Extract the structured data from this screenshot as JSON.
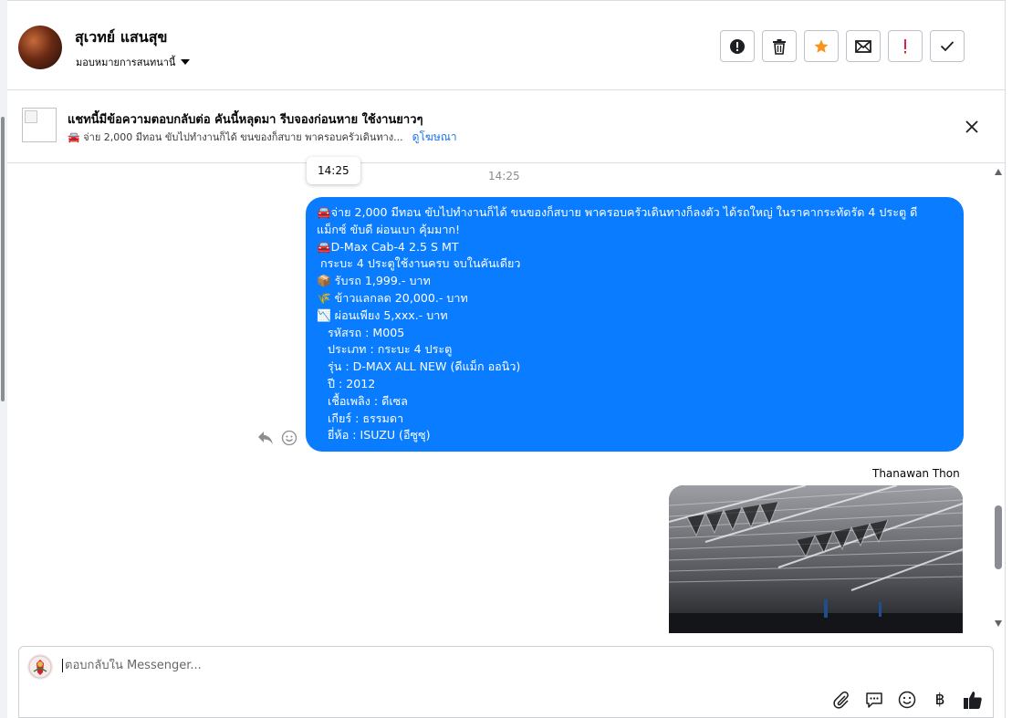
{
  "header": {
    "contact_name": "สุเวทย์ แสนสุข",
    "assign_label": "มอบหมายการสนทนานี้",
    "actions": [
      {
        "icon": "alert-circle-icon"
      },
      {
        "icon": "trash-icon"
      },
      {
        "icon": "star-icon",
        "color": "#f7931e"
      },
      {
        "icon": "envelope-icon"
      },
      {
        "icon": "exclamation-icon",
        "color": "#e41e3f"
      },
      {
        "icon": "checkmark-icon"
      }
    ]
  },
  "ad_banner": {
    "title": "แชทนี้มีข้อความตอบกลับต่อ คันนี้หลุดมา รีบจองก่อนหาย ใช้งานยาวๆ",
    "subtitle": "🚘 จ่าย 2,000 มีทอน ขับไปทำงานก็ได้ ขนของก็สบาย พาครอบครัวเดินทาง...",
    "link_label": "ดูโฆษณา"
  },
  "conversation": {
    "tooltip_time": "14:25",
    "timestamp": "14:25",
    "message_lines": [
      "🚘จ่าย 2,000 มีทอน ขับไปทำงานก็ได้ ขนของก็สบาย พาครอบครัวเดินทางก็ลงตัว ได้รถใหญ่ ในราคากระทัดรัด 4 ประตู ดี",
      "แม็กซ์ ขับดี ผ่อนเบา คุ้มมาก!",
      "🚘D-Max Cab-4 2.5 S MT",
      " กระบะ 4 ประตูใช้งานครบ จบในคันเดียว",
      "📦 รับรถ 1,999.- บาท",
      "🌾 ข้าวแลกลด 20,000.- บาท",
      "📉 ผ่อนเพียง 5,xxx.- บาท",
      "   รหัสรถ : M005",
      "   ประเภท : กระบะ 4 ประตู",
      "   รุ่น : D-MAX ALL NEW (ดีแม็ก ออนิว)",
      "   ปี : 2012",
      "   เชื้อเพลิง : ดีเซล",
      "   เกียร์ : ธรรมดา",
      "   ยี่ห้อ : ISUZU (อีซูซุ)"
    ],
    "sender_name": "Thanawan Thon",
    "bubble_color": "#0a7cff"
  },
  "composer": {
    "placeholder": "ตอบกลับใน Messenger...",
    "tools": [
      "paperclip-icon",
      "saved-reply-icon",
      "emoji-icon",
      "baht-icon",
      "thumbs-up-icon"
    ],
    "baht_symbol": "฿"
  }
}
